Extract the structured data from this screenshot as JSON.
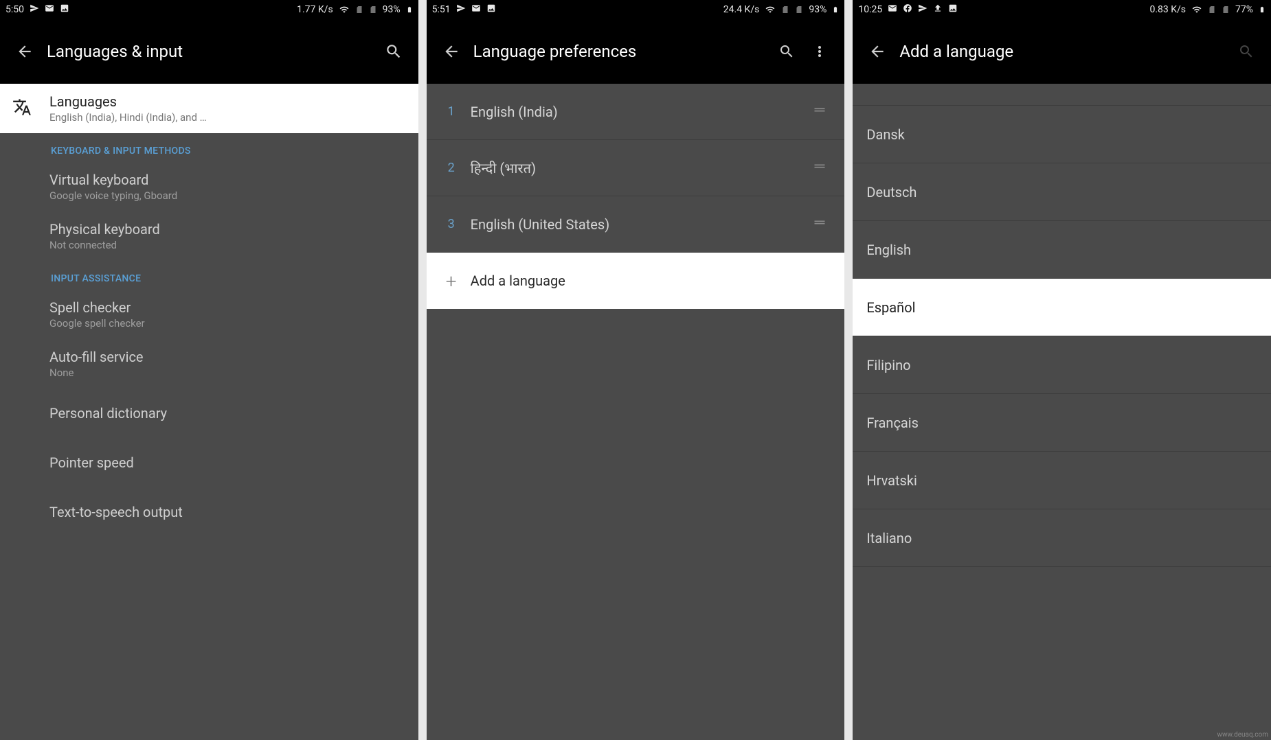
{
  "watermark": "www.deuaq.com",
  "panel1": {
    "status": {
      "time": "5:50",
      "net": "1.77 K/s",
      "batt": "93%"
    },
    "title": "Languages & input",
    "languages": {
      "title": "Languages",
      "sub": "English (India), Hindi (India), and …"
    },
    "section_kb": "KEYBOARD & INPUT METHODS",
    "virtualkb": {
      "title": "Virtual keyboard",
      "sub": "Google voice typing, Gboard"
    },
    "physkb": {
      "title": "Physical keyboard",
      "sub": "Not connected"
    },
    "section_assist": "INPUT ASSISTANCE",
    "spell": {
      "title": "Spell checker",
      "sub": "Google spell checker"
    },
    "autofill": {
      "title": "Auto-fill service",
      "sub": "None"
    },
    "dict": {
      "title": "Personal dictionary"
    },
    "pointer": {
      "title": "Pointer speed"
    },
    "tts": {
      "title": "Text-to-speech output"
    }
  },
  "panel2": {
    "status": {
      "time": "5:51",
      "net": "24.4 K/s",
      "batt": "93%"
    },
    "title": "Language preferences",
    "langs": [
      {
        "n": "1",
        "name": "English (India)"
      },
      {
        "n": "2",
        "name": "हिन्दी (भारत)"
      },
      {
        "n": "3",
        "name": "English (United States)"
      }
    ],
    "add": "Add a language"
  },
  "panel3": {
    "status": {
      "time": "10:25",
      "net": "0.83 K/s",
      "batt": "77%"
    },
    "title": "Add a language",
    "items": [
      "Dansk",
      "Deutsch",
      "English",
      "Español",
      "Filipino",
      "Français",
      "Hrvatski",
      "Italiano"
    ],
    "highlight_index": 3
  }
}
